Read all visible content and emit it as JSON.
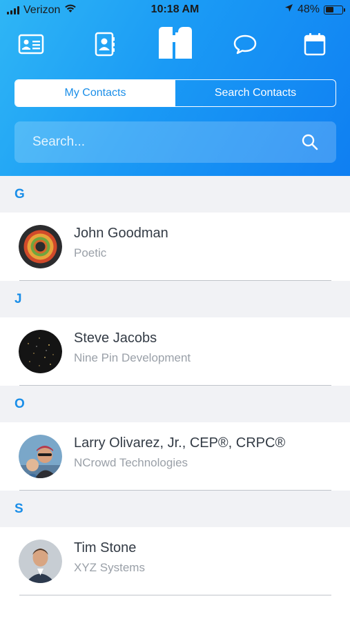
{
  "status_bar": {
    "carrier": "Verizon",
    "time": "10:18 AM",
    "battery_percent": "48%",
    "battery_level": 0.48
  },
  "nav": {
    "icons": [
      "profile-card-icon",
      "address-book-icon",
      "app-logo",
      "chat-bubble-icon",
      "calendar-icon"
    ]
  },
  "tabs": {
    "my_contacts": "My Contacts",
    "search_contacts": "Search Contacts",
    "active": "my_contacts"
  },
  "search": {
    "placeholder": "Search..."
  },
  "sections": [
    {
      "letter": "G",
      "contacts": [
        {
          "name": "John Goodman",
          "company": "Poetic"
        }
      ]
    },
    {
      "letter": "J",
      "contacts": [
        {
          "name": "Steve Jacobs",
          "company": "Nine Pin Development"
        }
      ]
    },
    {
      "letter": "O",
      "contacts": [
        {
          "name": "Larry Olivarez, Jr., CEP®, CRPC®",
          "company": "NCrowd Technologies"
        }
      ]
    },
    {
      "letter": "S",
      "contacts": [
        {
          "name": "Tim Stone",
          "company": "XYZ Systems"
        }
      ]
    }
  ],
  "colors": {
    "header_gradient_start": "#2fb6f5",
    "header_gradient_end": "#0f7ff2",
    "accent": "#1a8ee8",
    "section_bg": "#f1f2f5",
    "secondary_text": "#9aa0a8"
  }
}
